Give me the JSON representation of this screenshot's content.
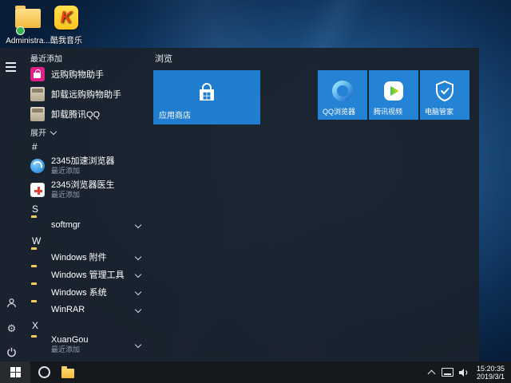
{
  "desktop": {
    "icons": [
      {
        "label": "Administra..."
      },
      {
        "label": "酷我音乐",
        "letter": "K"
      }
    ]
  },
  "start_menu": {
    "recent_header": "最近添加",
    "recent_items": [
      {
        "label": "远购购物助手"
      },
      {
        "label": "卸载远购购物助手"
      },
      {
        "label": "卸载腾讯QQ"
      }
    ],
    "expand_label": "展开",
    "sections": [
      {
        "letter": "#",
        "items": [
          {
            "label": "2345加速浏览器",
            "sub": "最近添加"
          },
          {
            "label": "2345浏览器医生",
            "sub": "最近添加"
          }
        ]
      },
      {
        "letter": "S",
        "items": [
          {
            "label": "softmgr"
          }
        ]
      },
      {
        "letter": "W",
        "items": [
          {
            "label": "Windows 附件"
          },
          {
            "label": "Windows 管理工具"
          },
          {
            "label": "Windows 系统"
          },
          {
            "label": "WinRAR"
          }
        ]
      },
      {
        "letter": "X",
        "items": [
          {
            "label": "XuanGou",
            "sub": "最近添加"
          }
        ]
      }
    ],
    "tiles": {
      "group_label": "浏览",
      "store_tile": {
        "label": "应用商店"
      },
      "small_tiles": [
        {
          "label": "QQ浏览器"
        },
        {
          "label": "腾讯视频"
        },
        {
          "label": "电脑管家"
        }
      ]
    }
  },
  "taskbar": {
    "clock": {
      "time": "15:20:35",
      "date": "2019/3/1"
    }
  },
  "colors": {
    "accent": "#2583d5",
    "tile_blue": "#2583d5",
    "taskbar_bg": "#15181d",
    "menu_bg": "rgba(26,35,45,0.95)"
  }
}
